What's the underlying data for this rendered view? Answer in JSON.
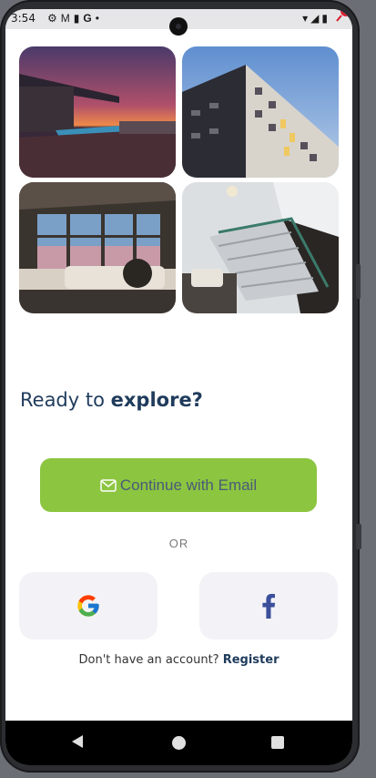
{
  "status_bar": {
    "time": "3:54",
    "left_icons": [
      "gear-icon",
      "gmail-icon",
      "battery-saver-icon",
      "google-icon",
      "dot-icon"
    ],
    "right_icons": [
      "wifi-icon",
      "signal-icon",
      "battery-icon"
    ]
  },
  "gallery": {
    "tiles": [
      {
        "name": "rooftop-pool-sunset",
        "colors": [
          "#2b1c3a",
          "#e07a4a"
        ]
      },
      {
        "name": "apartment-building",
        "colors": [
          "#7fa4d8",
          "#2a2a30"
        ]
      },
      {
        "name": "living-room-windows",
        "colors": [
          "#3b3630",
          "#c8a8b8"
        ]
      },
      {
        "name": "staircase-interior",
        "colors": [
          "#d8dcdf",
          "#2c2a28"
        ]
      }
    ]
  },
  "headline": {
    "prefix": "Ready to ",
    "emphasis": "explore?"
  },
  "email_button": {
    "label": "Continue with Email",
    "icon": "mail-icon",
    "color": "#8cc540"
  },
  "divider_text": "OR",
  "social": {
    "google_icon": "google-icon",
    "facebook_icon": "facebook-icon"
  },
  "signup": {
    "prompt": "Don't have an account?",
    "link": "Register"
  },
  "nav": {
    "back": "back-icon",
    "home": "home-icon",
    "recent": "recent-apps-icon"
  }
}
